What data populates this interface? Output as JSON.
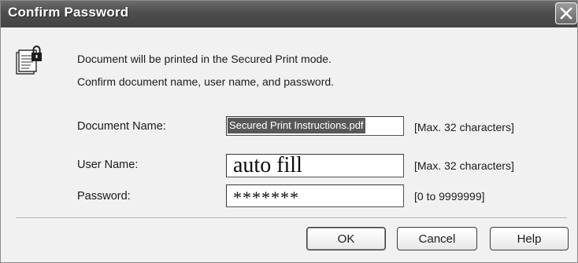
{
  "dialog": {
    "title": "Confirm Password",
    "close_icon": "close-icon"
  },
  "message": {
    "icon": "locked-document-icon",
    "line1": "Document will be printed in the Secured Print mode.",
    "line2": "Confirm document name, user name, and password."
  },
  "fields": {
    "document_name": {
      "label": "Document Name:",
      "value": "Secured Print Instructions.pdf",
      "hint": "[Max. 32 characters]"
    },
    "user_name": {
      "label": "User Name:",
      "value": "auto fill",
      "hint": "[Max. 32 characters]"
    },
    "password": {
      "label": "Password:",
      "value": "*******",
      "hint": "[0 to 9999999]"
    }
  },
  "buttons": {
    "ok": "OK",
    "cancel": "Cancel",
    "help": "Help"
  },
  "colors": {
    "titlebar": "#4f4f4f",
    "dialog_background": "#ececec",
    "selection": "#5a5a5a"
  }
}
